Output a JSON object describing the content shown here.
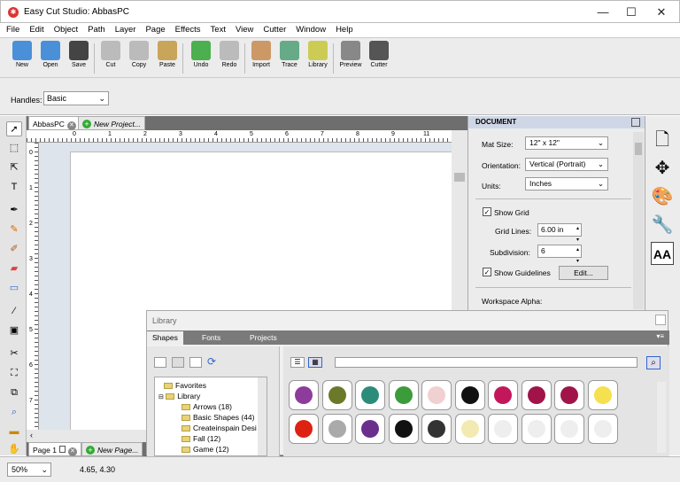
{
  "window": {
    "title": "Easy Cut Studio: AbbasPC",
    "minimize": "—",
    "maximize": "☐",
    "close": "✕"
  },
  "menu": [
    "File",
    "Edit",
    "Object",
    "Path",
    "Layer",
    "Page",
    "Effects",
    "Text",
    "View",
    "Cutter",
    "Window",
    "Help"
  ],
  "toolbar": [
    {
      "label": "New",
      "icon": "new-icon",
      "color": "#4a90d9"
    },
    {
      "label": "Open",
      "icon": "open-icon",
      "color": "#4a90d9"
    },
    {
      "label": "Save",
      "icon": "save-icon",
      "color": "#444"
    },
    {
      "label": "Cut",
      "icon": "cut-icon",
      "color": "#aaa"
    },
    {
      "label": "Copy",
      "icon": "copy-icon",
      "color": "#aaa"
    },
    {
      "label": "Paste",
      "icon": "paste-icon",
      "color": "#c9a55a"
    },
    {
      "label": "Undo",
      "icon": "undo-icon",
      "color": "#4caf50"
    },
    {
      "label": "Redo",
      "icon": "redo-icon",
      "color": "#aaa"
    },
    {
      "label": "Import",
      "icon": "import-icon",
      "color": "#c96"
    },
    {
      "label": "Trace",
      "icon": "trace-icon",
      "color": "#6a8"
    },
    {
      "label": "Library",
      "icon": "library-icon",
      "color": "#cc5"
    },
    {
      "label": "Preview",
      "icon": "preview-icon",
      "color": "#777"
    },
    {
      "label": "Cutter",
      "icon": "cutter-icon",
      "color": "#555"
    }
  ],
  "handles": {
    "label": "Handles:",
    "value": "Basic"
  },
  "tabs": {
    "doc": "AbbasPC",
    "new_project": "New Project..."
  },
  "ruler": {
    "h": [
      "0",
      "1",
      "2",
      "3",
      "4",
      "5",
      "6",
      "7",
      "8",
      "9",
      "10",
      "11"
    ],
    "v": [
      "0",
      "1",
      "2",
      "3",
      "4",
      "5",
      "6",
      "7",
      "8"
    ]
  },
  "document": {
    "header": "DOCUMENT",
    "mat_size_label": "Mat Size:",
    "mat_size": "12\" x 12\"",
    "orientation_label": "Orientation:",
    "orientation": "Vertical (Portrait)",
    "units_label": "Units:",
    "units": "Inches",
    "show_grid": "Show Grid",
    "grid_lines_label": "Grid Lines:",
    "grid_lines": "6.00 in",
    "subdivision_label": "Subdivision:",
    "subdivision": "6",
    "show_guidelines": "Show Guidelines",
    "edit": "Edit...",
    "workspace_alpha": "Workspace Alpha:"
  },
  "bottom_tabs": {
    "page": "Page 1",
    "new_page": "New Page..."
  },
  "library": {
    "title": "Library",
    "tabs": [
      "Shapes",
      "Fonts",
      "Projects"
    ],
    "tree": [
      {
        "label": "Favorites",
        "indent": 1
      },
      {
        "label": "Library",
        "indent": 1
      },
      {
        "label": "Arrows (18)",
        "indent": 2
      },
      {
        "label": "Basic Shapes (44)",
        "indent": 2
      },
      {
        "label": "Createinspain Desi",
        "indent": 2
      },
      {
        "label": "Fall (12)",
        "indent": 2
      },
      {
        "label": "Game (12)",
        "indent": 2
      }
    ],
    "shapes": [
      {
        "name": "bow-shape",
        "color": "#8e3c9c"
      },
      {
        "name": "leaf-outline-shape",
        "color": "#6b7a2a"
      },
      {
        "name": "fern-leaf-shape",
        "color": "#2b8c7a"
      },
      {
        "name": "green-leaf-shape",
        "color": "#3c9c3c"
      },
      {
        "name": "flower-faint-shape",
        "color": "#f0d0d0"
      },
      {
        "name": "penguin-shape",
        "color": "#111"
      },
      {
        "name": "pink-flower-shape",
        "color": "#c2185b"
      },
      {
        "name": "oval-frame-shape",
        "color": "#a0144a"
      },
      {
        "name": "round-frame-shape",
        "color": "#a0144a"
      },
      {
        "name": "yellow-flower-shape",
        "color": "#f5e050"
      },
      {
        "name": "red-flower-shape",
        "color": "#d21"
      },
      {
        "name": "swirl-shape",
        "color": "#aaa"
      },
      {
        "name": "teapot-shape",
        "color": "#6a2e8c"
      },
      {
        "name": "top-hat-shape",
        "color": "#111"
      },
      {
        "name": "tree-shape",
        "color": "#333"
      },
      {
        "name": "yellow-square-shape",
        "color": "#f2eab0"
      },
      {
        "name": "blank-shape-1",
        "color": "#eee"
      },
      {
        "name": "blank-shape-2",
        "color": "#eee"
      },
      {
        "name": "blank-shape-3",
        "color": "#eee"
      },
      {
        "name": "blank-shape-4",
        "color": "#eee"
      }
    ]
  },
  "status": {
    "zoom": "50%",
    "coords": "4.65, 4.30"
  }
}
